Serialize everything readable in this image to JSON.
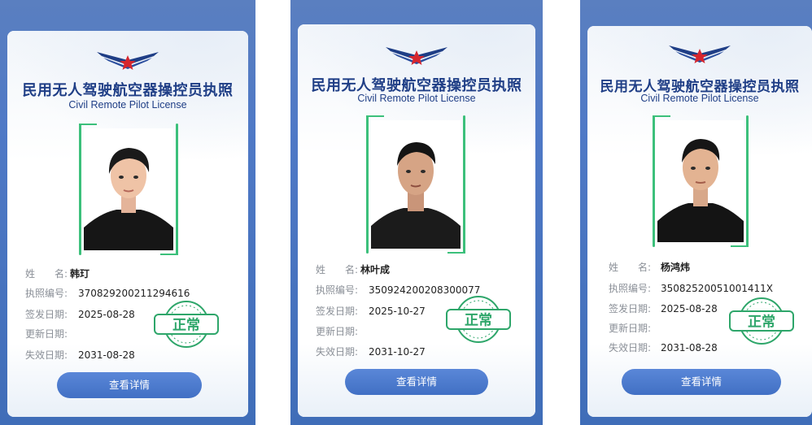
{
  "colors": {
    "brand_blue": "#1f3e86",
    "stamp_green": "#2ea66a",
    "button_blue": "#4a7bd0"
  },
  "cards": [
    {
      "title_cn": "民用无人驾驶航空器操控员执照",
      "title_en": "Civil Remote Pilot License",
      "fields": {
        "name_label": "姓　　名:",
        "name": "韩玎",
        "license_label": "执照编号:",
        "license_no": "370829200211294616",
        "issue_label": "签发日期:",
        "issue_date": "2025-08-28",
        "renew_label": "更新日期:",
        "renew_date": "",
        "expire_label": "失效日期:",
        "expire_date": "2031-08-28"
      },
      "status": "正常",
      "button": "查看详情"
    },
    {
      "title_cn": "民用无人驾驶航空器操控员执照",
      "title_en": "Civil Remote Pilot License",
      "fields": {
        "name_label": "姓　　名:",
        "name": "林叶成",
        "license_label": "执照编号:",
        "license_no": "350924200208300077",
        "issue_label": "签发日期:",
        "issue_date": "2025-10-27",
        "renew_label": "更新日期:",
        "renew_date": "",
        "expire_label": "失效日期:",
        "expire_date": "2031-10-27"
      },
      "status": "正常",
      "button": "查看详情"
    },
    {
      "title_cn": "民用无人驾驶航空器操控员执照",
      "title_en": "Civil Remote Pilot License",
      "fields": {
        "name_label": "姓　　名:",
        "name": "杨鸿炜",
        "license_label": "执照编号:",
        "license_no": "35082520051001411X",
        "issue_label": "签发日期:",
        "issue_date": "2025-08-28",
        "renew_label": "更新日期:",
        "renew_date": "",
        "expire_label": "失效日期:",
        "expire_date": "2031-08-28"
      },
      "status": "正常",
      "button": "查看详情"
    }
  ]
}
